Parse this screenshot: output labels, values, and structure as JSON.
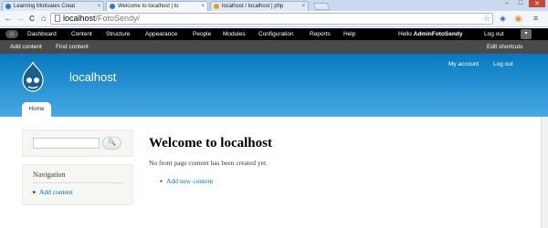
{
  "browser": {
    "tabs": [
      {
        "title": "Learning Motivates Creat",
        "active": false,
        "favicon_color": "#2a77c9"
      },
      {
        "title": "Welcome to localhost | lo",
        "active": true,
        "favicon_color": "#2a77c9"
      },
      {
        "title": "localhost / localhost | php",
        "active": false,
        "favicon_color": "#e0a030"
      }
    ],
    "tab_close": "×",
    "window_controls": {
      "minimize": "–",
      "maximize": "□",
      "close": "✕"
    },
    "nav": {
      "back": "←",
      "forward": "→",
      "reload": "C",
      "home": "⌂"
    },
    "address": {
      "host": "localhost",
      "path": "/FotoSendy/"
    },
    "toolbar_icons": {
      "star": "☆",
      "ext1": "◈",
      "rss": "◉",
      "menu": "≡"
    }
  },
  "admin_toolbar": {
    "home_icon": "⌂",
    "menu": [
      "Dashboard",
      "Content",
      "Structure",
      "Appearance",
      "People",
      "Modules",
      "Configuration",
      "Reports",
      "Help"
    ],
    "hello_prefix": "Hello",
    "username": "AdminFotoSendy",
    "logout": "Log out",
    "drawer_icon": "▾",
    "shortcuts": [
      "Add content",
      "Find content"
    ],
    "edit_shortcuts": "Edit shortcuts"
  },
  "header": {
    "site_name": "localhost",
    "secondary_menu": [
      "My account",
      "Log out"
    ],
    "main_tab": "Home",
    "colors": {
      "top": "#0779bf",
      "bottom": "#48a9e4"
    }
  },
  "sidebar": {
    "search": {
      "button_icon": "🔍"
    },
    "navigation": {
      "title": "Navigation",
      "items": [
        "Add content"
      ]
    }
  },
  "main": {
    "title": "Welcome to localhost",
    "message": "No front page content has been created yet.",
    "link": "Add new content"
  }
}
